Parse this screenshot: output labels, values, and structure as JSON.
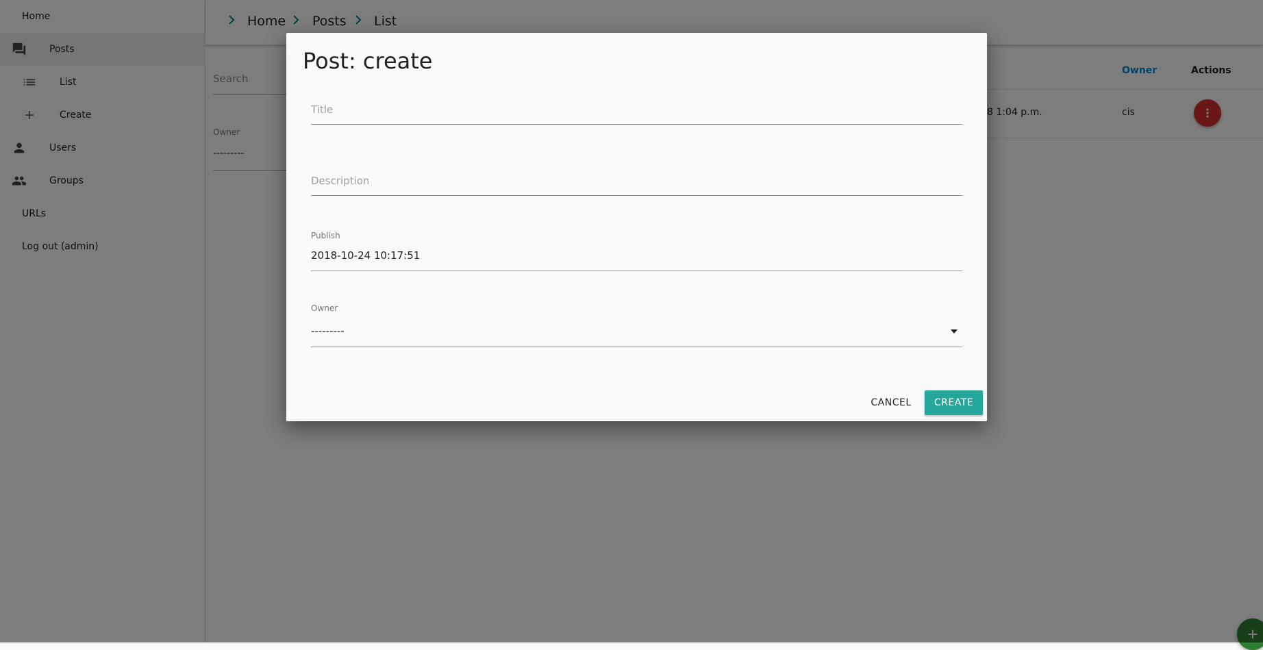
{
  "sidebar": {
    "home": "Home",
    "posts": "Posts",
    "list": "List",
    "create": "Create",
    "users": "Users",
    "groups": "Groups",
    "urls": "URLs",
    "logout": "Log out (admin)"
  },
  "breadcrumb": [
    "Home",
    "Posts",
    "List"
  ],
  "list_page": {
    "search_placeholder": "Search",
    "owner_filter_label": "Owner",
    "owner_filter_value": "---------",
    "columns": {
      "owner": "Owner",
      "actions": "Actions"
    },
    "row": {
      "published_partial": "8 1:04 p.m.",
      "owner": "cis"
    }
  },
  "dialog": {
    "title": "Post: create",
    "fields": {
      "title": {
        "placeholder": "Title"
      },
      "description": {
        "placeholder": "Description"
      },
      "publish": {
        "label": "Publish",
        "value": "2018-10-24 10:17:51"
      },
      "owner": {
        "label": "Owner",
        "value": "---------"
      }
    },
    "cancel": "CANCEL",
    "create": "CREATE"
  },
  "colors": {
    "accent": "#26a69a",
    "breadcrumb_chevron": "#00897b",
    "owner_header": "#0288d1",
    "actions_fab": "#d32f2f",
    "add_fab": "#2e7d32"
  },
  "icons": {
    "posts": "forum-icon",
    "list": "list-icon",
    "create": "add-icon",
    "users": "person-icon",
    "groups": "group-icon",
    "breadcrumb_separator": "chevron-right-icon",
    "row_actions": "more-vert-icon",
    "owner_dropdown": "arrow-drop-down-icon",
    "add": "add-icon"
  }
}
